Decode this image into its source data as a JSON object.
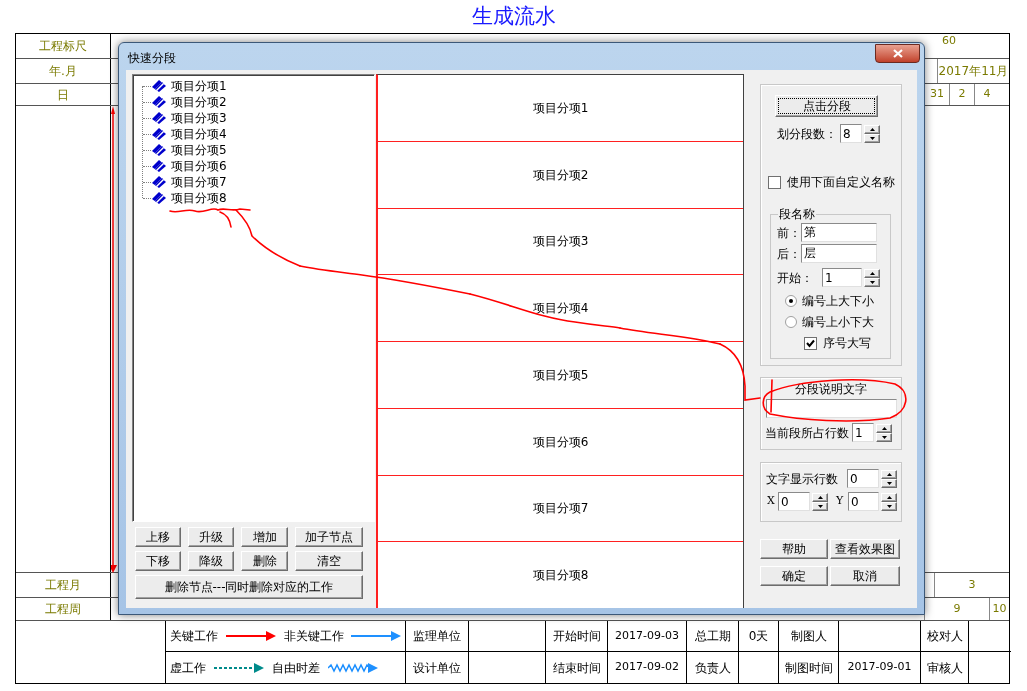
{
  "page_title": "生成流水",
  "ruler": {
    "label": "工程标尺",
    "ticks": [
      "60"
    ]
  },
  "month_row": {
    "label": "年.月",
    "cells": [
      "2017年11月"
    ]
  },
  "day_row": {
    "label": "日",
    "cells": [
      "31",
      "2",
      "4"
    ]
  },
  "project_month_row": {
    "label": "工程月",
    "cells": [
      "3"
    ]
  },
  "project_week_row": {
    "label": "工程周",
    "cells": [
      "9",
      "10"
    ]
  },
  "dialog": {
    "title": "快速分段",
    "tree": [
      {
        "label": "项目分项1"
      },
      {
        "label": "项目分项2"
      },
      {
        "label": "项目分项3"
      },
      {
        "label": "项目分项4"
      },
      {
        "label": "项目分项5"
      },
      {
        "label": "项目分项6"
      },
      {
        "label": "项目分项7"
      },
      {
        "label": "项目分项8"
      }
    ],
    "tree_buttons": [
      "上移",
      "升级",
      "增加",
      "加子节点",
      "下移",
      "降级",
      "删除",
      "清空"
    ],
    "delete_button": "删除节点---同时删除对应的工作",
    "segments": [
      "项目分项1",
      "项目分项2",
      "项目分项3",
      "项目分项4",
      "项目分项5",
      "项目分项6",
      "项目分项7",
      "项目分项8"
    ],
    "split_button": "点击分段",
    "segment_count": {
      "label": "划分段数：",
      "value": "8"
    },
    "custom_name": {
      "label": "使用下面自定义名称",
      "checked": false
    },
    "name_group": {
      "title": "段名称",
      "prefix": {
        "label": "前：",
        "value": "第"
      },
      "suffix": {
        "label": "后：",
        "value": "层"
      },
      "start": {
        "label": "开始：",
        "value": "1"
      },
      "order_options": [
        {
          "label": "编号上大下小",
          "selected": true
        },
        {
          "label": "编号上小下大",
          "selected": false
        }
      ],
      "uppercase": {
        "label": "序号大写",
        "checked": true
      }
    },
    "description": {
      "label": "分段说明文字",
      "rows_label": "当前段所占行数",
      "rows_value": "1"
    },
    "display": {
      "rows_label": "文字显示行数",
      "rows_value": "0",
      "x_label": "X",
      "x_value": "0",
      "y_label": "Y",
      "y_value": "0"
    },
    "buttons": [
      "帮助",
      "查看效果图",
      "确定",
      "取消"
    ]
  },
  "legend": [
    {
      "label": "关键工作",
      "kind": "solid",
      "color": "#ff0000"
    },
    {
      "label": "非关键工作",
      "kind": "solid",
      "color": "#1e90ff"
    },
    {
      "label": "虚工作",
      "kind": "dashed",
      "color": "#008b8b"
    },
    {
      "label": "自由时差",
      "kind": "wavy",
      "color": "#1e90ff"
    }
  ],
  "info_table": {
    "rows": [
      {
        "unit_label": "监理单位",
        "time_label": "开始时间",
        "date": "2017-09-03",
        "period_label": "总工期",
        "period_value": "0天",
        "person_label": "制图人",
        "check_label": "校对人"
      },
      {
        "unit_label": "设计单位",
        "time_label": "结束时间",
        "date": "2017-09-02",
        "period_label": "负责人",
        "person_label": "制图时间",
        "person_value": "2017-09-01",
        "check_label": "审核人"
      }
    ]
  }
}
